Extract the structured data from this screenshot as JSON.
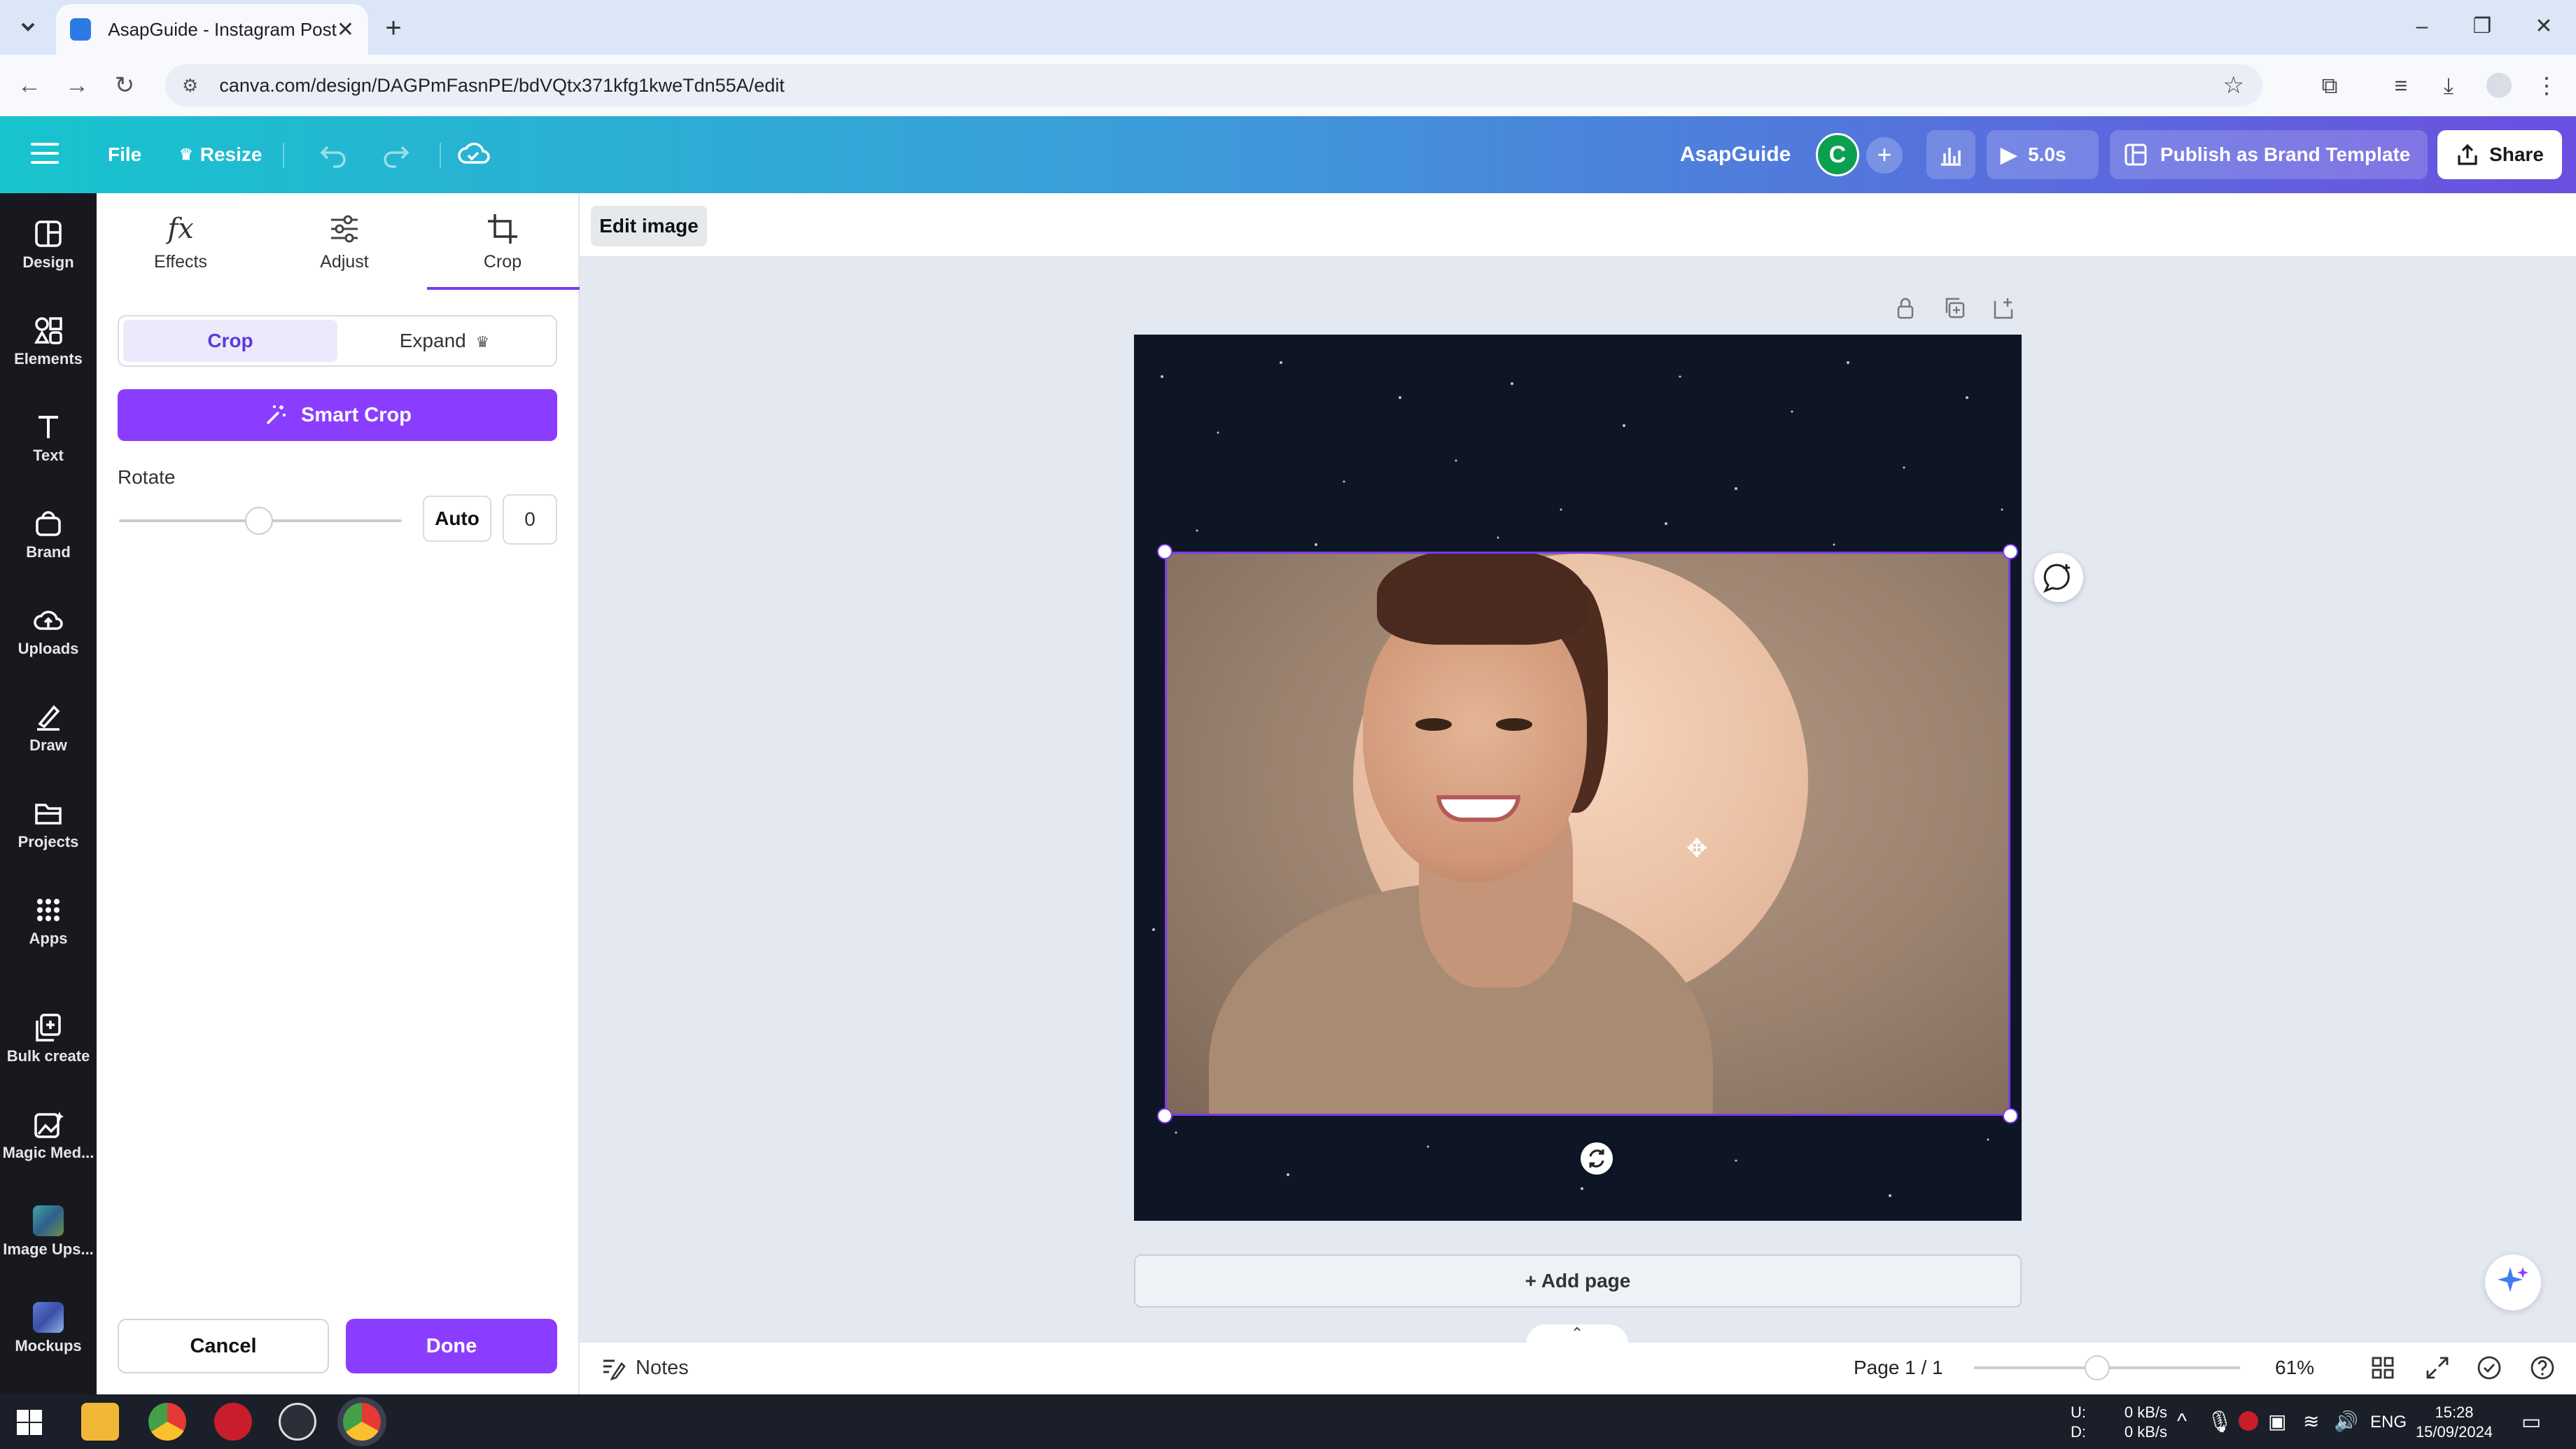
{
  "browser": {
    "tab_title": "AsapGuide - Instagram Post",
    "url": "canva.com/design/DAGPmFasnPE/bdVQtx371kfg1kweTdn55A/edit"
  },
  "header": {
    "menu_icon": "hamburger-icon",
    "file_label": "File",
    "resize_label": "Resize",
    "brand_name": "AsapGuide",
    "avatar_initial": "C",
    "duration_label": "5.0s",
    "publish_label": "Publish as Brand Template",
    "share_label": "Share",
    "colors": {
      "gradient_start": "#17c4ce",
      "gradient_end": "#6b4fe0",
      "avatar": "#0aa04f"
    }
  },
  "rail": {
    "items": [
      {
        "label": "Design",
        "icon": "design-icon"
      },
      {
        "label": "Elements",
        "icon": "elements-icon"
      },
      {
        "label": "Text",
        "icon": "text-icon"
      },
      {
        "label": "Brand",
        "icon": "brand-icon"
      },
      {
        "label": "Uploads",
        "icon": "uploads-icon"
      },
      {
        "label": "Draw",
        "icon": "draw-icon"
      },
      {
        "label": "Projects",
        "icon": "projects-icon"
      },
      {
        "label": "Apps",
        "icon": "apps-icon"
      },
      {
        "label": "Bulk create",
        "icon": "bulk-create-icon"
      },
      {
        "label": "Magic Med...",
        "icon": "magic-media-icon"
      },
      {
        "label": "Image Ups...",
        "icon": "image-upscaler-icon"
      },
      {
        "label": "Mockups",
        "icon": "mockups-icon"
      }
    ]
  },
  "panel": {
    "tabs": [
      {
        "label": "Effects",
        "icon": "fx-icon"
      },
      {
        "label": "Adjust",
        "icon": "sliders-icon"
      },
      {
        "label": "Crop",
        "icon": "crop-icon"
      }
    ],
    "active_tab": "Crop",
    "segment": {
      "crop": "Crop",
      "expand": "Expand"
    },
    "smart_crop_label": "Smart Crop",
    "rotate_label": "Rotate",
    "rotate_value": "0",
    "auto_label": "Auto",
    "cancel_label": "Cancel",
    "done_label": "Done",
    "accent": "#8b3dff"
  },
  "editor": {
    "edit_image_label": "Edit image",
    "add_page_label": "+ Add page",
    "notes_label": "Notes",
    "page_indicator": "Page 1 / 1",
    "zoom": "61%"
  },
  "taskbar": {
    "net_up": "0 kB/s",
    "net_down": "0 kB/s",
    "net_up_label": "U:",
    "net_down_label": "D:",
    "language": "ENG",
    "time": "15:28",
    "date": "15/09/2024"
  }
}
